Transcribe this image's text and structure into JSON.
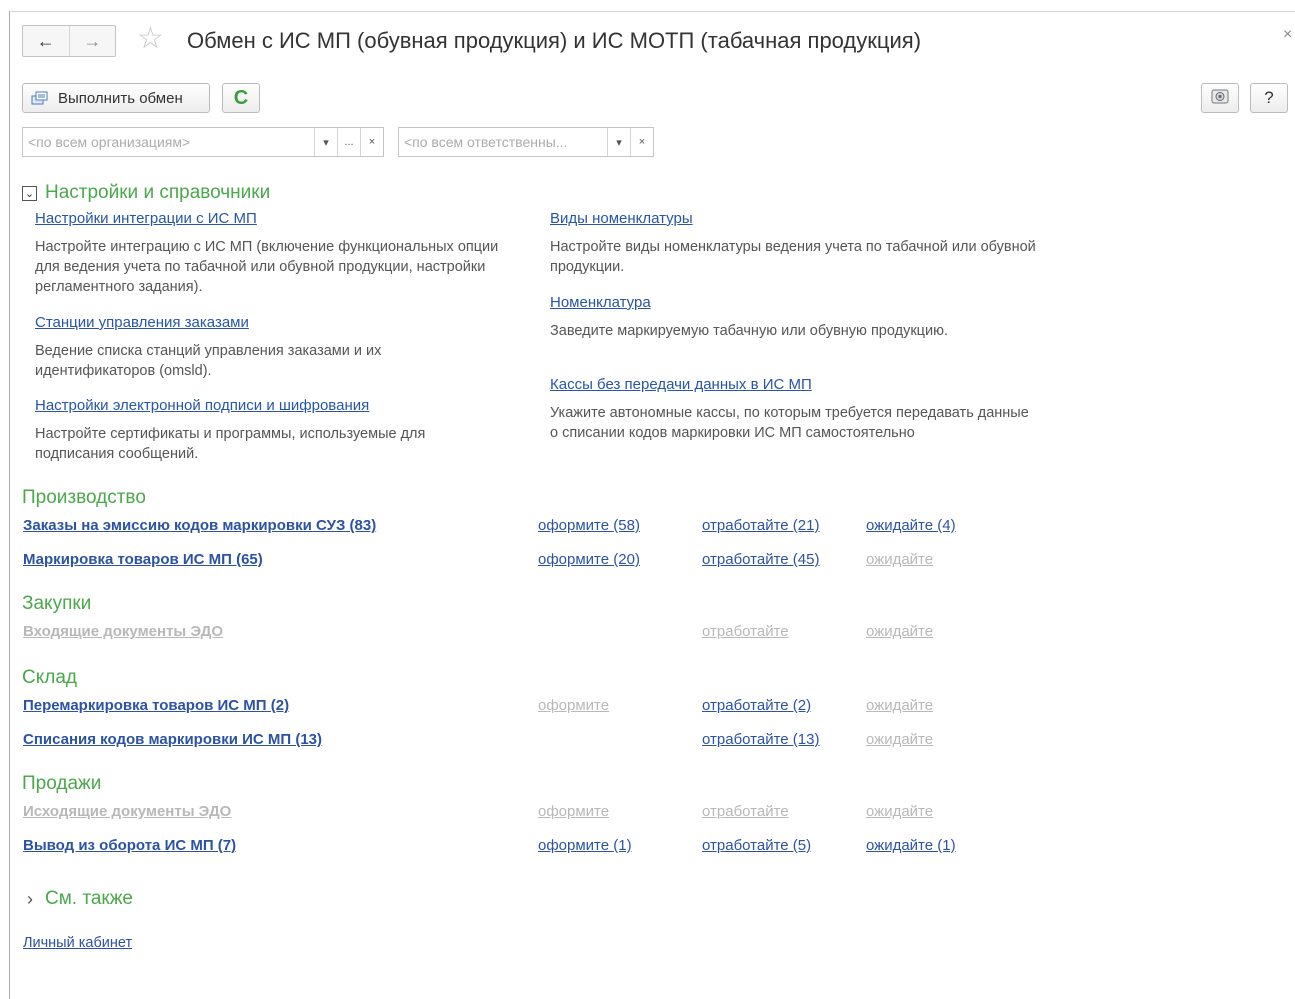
{
  "window": {
    "title": "Обмен с ИС МП (обувная продукция) и ИС МОТП (табачная продукция)",
    "back_glyph": "←",
    "forward_glyph": "→",
    "favorite_glyph": "☆",
    "close_glyph": "×"
  },
  "toolbar": {
    "exec_label": "Выполнить обмен",
    "refresh_glyph": "C",
    "help_label": "?"
  },
  "filters": {
    "organization": {
      "placeholder": "<по всем организациям>",
      "dropdown": "▾",
      "select": "...",
      "clear": "×"
    },
    "responsible": {
      "placeholder": "<по всем ответственны...",
      "dropdown": "▾",
      "clear": "×"
    }
  },
  "settings": {
    "title": "Настройки и справочники",
    "toggle_glyph": "⌄",
    "items_left": [
      {
        "link": "Настройки интеграции с ИС МП",
        "desc": "Настройте интеграцию с ИС МП (включение функциональных опции для ведения учета по табачной или обувной продукции, настройки регламентного задания)."
      },
      {
        "link": "Станции управления заказами",
        "desc": "Ведение списка станций управления заказами и их идентификаторов (omsld)."
      },
      {
        "link": "Настройки электронной подписи и шифрования",
        "desc": "Настройте сертификаты и программы, используемые для подписания сообщений."
      }
    ],
    "items_right": [
      {
        "link": "Виды номенклатуры",
        "desc": "Настройте виды номенклатуры ведения учета по табачной или обувной продукции."
      },
      {
        "link": "Номенклатура",
        "desc": "Заведите маркируемую табачную или обувную продукцию."
      },
      {
        "link": "Кассы без передачи данных в ИС МП",
        "desc": "Укажите автономные кассы, по которым требуется передавать данные о списании кодов маркировки ИС МП самостоятельно"
      }
    ]
  },
  "groups": {
    "production": {
      "title": "Производство",
      "rows": [
        {
          "label": "Заказы на эмиссию кодов маркировки СУЗ (83)",
          "a1": "оформите (58)",
          "a2": "отработайте (21)",
          "a3": "ожидайте (4)"
        },
        {
          "label": "Маркировка товаров ИС МП (65)",
          "a1": "оформите (20)",
          "a2": "отработайте (45)",
          "a3": "ожидайте"
        }
      ]
    },
    "purchases": {
      "title": "Закупки",
      "rows": [
        {
          "label": "Входящие документы ЭДО",
          "a2": "отработайте",
          "a3": "ожидайте"
        }
      ]
    },
    "warehouse": {
      "title": "Склад",
      "rows": [
        {
          "label": "Перемаркировка товаров ИС МП (2)",
          "a1": "оформите",
          "a2": "отработайте (2)",
          "a3": "ожидайте"
        },
        {
          "label": "Списания кодов маркировки ИС МП (13)",
          "a2": "отработайте (13)",
          "a3": "ожидайте"
        }
      ]
    },
    "sales": {
      "title": "Продажи",
      "rows": [
        {
          "label": "Исходящие документы ЭДО",
          "a1": "оформите",
          "a2": "отработайте",
          "a3": "ожидайте"
        },
        {
          "label": "Вывод из оборота ИС МП (7)",
          "a1": "оформите (1)",
          "a2": "отработайте (5)",
          "a3": "ожидайте (1)"
        }
      ]
    }
  },
  "see_also": {
    "title": "См. также",
    "chevron": "›"
  },
  "footer": {
    "cabinet_link": "Личный кабинет"
  },
  "colors": {
    "section_green": "#4aa84a",
    "link_blue": "#2c52a3",
    "disabled_gray": "#b8b8b8"
  },
  "icons": {
    "exec": "exchange-icon",
    "refresh": "refresh-icon",
    "screenshot": "screenshot-icon",
    "favorite": "star-icon"
  }
}
